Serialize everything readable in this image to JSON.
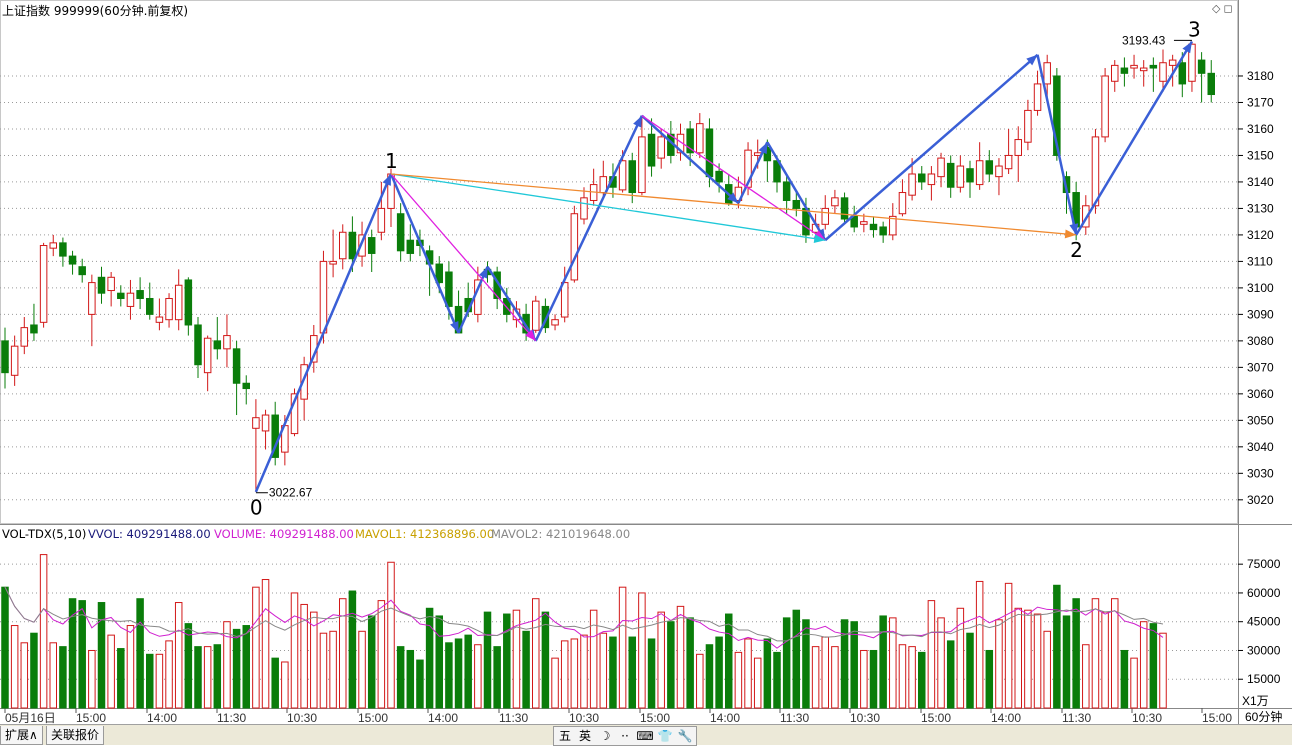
{
  "header": {
    "title": "上证指数 999999(60分钟.前复权)",
    "window_controls": "◇◻"
  },
  "volume_header": {
    "indicator": "VOL-TDX(5,10)",
    "vvol": "VVOL: 409291488.00",
    "volume": "VOLUME: 409291488.00",
    "mavol1": "MAVOL1: 412368896.00",
    "mavol2": "MAVOL2: 421019648.00"
  },
  "annotations": {
    "low_label": "3022.67",
    "high_label": "3193.43",
    "wave_labels": [
      "0",
      "1",
      "2",
      "3"
    ]
  },
  "bottom_bar": {
    "tab_expand": "扩展∧",
    "tab_quote": "关联报价",
    "ime_buttons": [
      "五",
      "英",
      "☽",
      "··",
      "⌨",
      "👕",
      "🔧"
    ]
  },
  "colors": {
    "up": "#d21818",
    "down": "#0a7d0a",
    "grid": "#9a9a9a",
    "wave_blue": "#3a5fd6",
    "wave_magenta": "#e020e0",
    "wave_cyan": "#20c8d8",
    "wave_orange": "#f08a30",
    "vvol_color": "#1a1a7a",
    "volume_color": "#d020d0",
    "mavol1_color": "#c8a000",
    "mavol2_color": "#888888"
  },
  "chart_data": {
    "type": "candlestick",
    "price_axis": {
      "ticks": [
        3020,
        3030,
        3040,
        3050,
        3060,
        3070,
        3080,
        3090,
        3100,
        3110,
        3120,
        3130,
        3140,
        3150,
        3160,
        3170,
        3180
      ],
      "range": [
        3012,
        3200
      ]
    },
    "volume_axis": {
      "ticks": [
        15000,
        30000,
        45000,
        60000,
        75000
      ],
      "unit": "X1万",
      "range": [
        0,
        85000
      ]
    },
    "x_axis": {
      "labels": [
        "05月16日",
        "15:00",
        "14:00",
        "11:30",
        "10:30",
        "15:00",
        "14:00",
        "11:30",
        "10:30",
        "15:00",
        "14:00",
        "11:30",
        "10:30",
        "15:00",
        "14:00",
        "11:30",
        "10:30",
        "15:00"
      ],
      "period_label": "60分钟"
    },
    "candles": [
      [
        3080,
        3068,
        3085,
        3062
      ],
      [
        3067,
        3078,
        3082,
        3063
      ],
      [
        3078,
        3085,
        3089,
        3075
      ],
      [
        3086,
        3083,
        3094,
        3080
      ],
      [
        3087,
        3116,
        3117,
        3085
      ],
      [
        3115,
        3117,
        3120,
        3112
      ],
      [
        3117,
        3112,
        3119,
        3108
      ],
      [
        3112,
        3109,
        3114,
        3105
      ],
      [
        3108,
        3105,
        3111,
        3102
      ],
      [
        3090,
        3102,
        3105,
        3078
      ],
      [
        3104,
        3098,
        3108,
        3094
      ],
      [
        3099,
        3104,
        3106,
        3093
      ],
      [
        3098,
        3096,
        3101,
        3093
      ],
      [
        3093,
        3098,
        3103,
        3088
      ],
      [
        3099,
        3096,
        3104,
        3092
      ],
      [
        3096,
        3090,
        3102,
        3088
      ],
      [
        3087,
        3089,
        3096,
        3084
      ],
      [
        3088,
        3096,
        3098,
        3085
      ],
      [
        3088,
        3101,
        3107,
        3084
      ],
      [
        3103,
        3086,
        3104,
        3082
      ],
      [
        3086,
        3071,
        3089,
        3066
      ],
      [
        3068,
        3081,
        3082,
        3061
      ],
      [
        3080,
        3077,
        3089,
        3073
      ],
      [
        3077,
        3082,
        3090,
        3070
      ],
      [
        3077,
        3064,
        3080,
        3052
      ],
      [
        3064,
        3062,
        3067,
        3056
      ],
      [
        3047,
        3051,
        3058,
        3023
      ],
      [
        3046,
        3052,
        3054,
        3039
      ],
      [
        3052,
        3036,
        3057,
        3033
      ],
      [
        3038,
        3048,
        3052,
        3033
      ],
      [
        3045,
        3060,
        3062,
        3044
      ],
      [
        3058,
        3071,
        3074,
        3050
      ],
      [
        3072,
        3082,
        3086,
        3068
      ],
      [
        3083,
        3110,
        3114,
        3079
      ],
      [
        3109,
        3110,
        3122,
        3104
      ],
      [
        3111,
        3121,
        3124,
        3107
      ],
      [
        3121,
        3111,
        3127,
        3106
      ],
      [
        3112,
        3120,
        3125,
        3108
      ],
      [
        3119,
        3113,
        3122,
        3106
      ],
      [
        3121,
        3130,
        3140,
        3118
      ],
      [
        3130,
        3143,
        3145,
        3123
      ],
      [
        3128,
        3114,
        3132,
        3110
      ],
      [
        3118,
        3113,
        3124,
        3110
      ],
      [
        3118,
        3116,
        3122,
        3112
      ],
      [
        3114,
        3109,
        3116,
        3097
      ],
      [
        3109,
        3102,
        3112,
        3098
      ],
      [
        3106,
        3093,
        3110,
        3088
      ],
      [
        3093,
        3083,
        3099,
        3083
      ],
      [
        3096,
        3091,
        3102,
        3089
      ],
      [
        3090,
        3103,
        3108,
        3087
      ],
      [
        3107,
        3105,
        3110,
        3102
      ],
      [
        3106,
        3096,
        3108,
        3092
      ],
      [
        3096,
        3090,
        3100,
        3087
      ],
      [
        3088,
        3092,
        3095,
        3085
      ],
      [
        3090,
        3083,
        3094,
        3080
      ],
      [
        3084,
        3095,
        3097,
        3083
      ],
      [
        3093,
        3085,
        3096,
        3083
      ],
      [
        3086,
        3088,
        3090,
        3084
      ],
      [
        3089,
        3102,
        3108,
        3087
      ],
      [
        3103,
        3128,
        3131,
        3102
      ],
      [
        3126,
        3134,
        3138,
        3124
      ],
      [
        3133,
        3139,
        3145,
        3131
      ],
      [
        3136,
        3142,
        3148,
        3134
      ],
      [
        3142,
        3138,
        3147,
        3134
      ],
      [
        3137,
        3148,
        3152,
        3136
      ],
      [
        3148,
        3136,
        3151,
        3132
      ],
      [
        3136,
        3157,
        3165,
        3135
      ],
      [
        3158,
        3146,
        3164,
        3142
      ],
      [
        3149,
        3157,
        3160,
        3145
      ],
      [
        3158,
        3150,
        3163,
        3147
      ],
      [
        3151,
        3158,
        3162,
        3148
      ],
      [
        3160,
        3151,
        3163,
        3146
      ],
      [
        3151,
        3162,
        3166,
        3149
      ],
      [
        3160,
        3142,
        3164,
        3138
      ],
      [
        3144,
        3140,
        3147,
        3136
      ],
      [
        3139,
        3132,
        3143,
        3131
      ],
      [
        3133,
        3138,
        3142,
        3130
      ],
      [
        3138,
        3152,
        3155,
        3135
      ],
      [
        3150,
        3151,
        3156,
        3145
      ],
      [
        3153,
        3148,
        3156,
        3140
      ],
      [
        3148,
        3140,
        3150,
        3136
      ],
      [
        3140,
        3133,
        3143,
        3128
      ],
      [
        3133,
        3130,
        3136,
        3127
      ],
      [
        3130,
        3120,
        3134,
        3117
      ],
      [
        3121,
        3124,
        3128,
        3118
      ],
      [
        3124,
        3130,
        3135,
        3122
      ],
      [
        3131,
        3134,
        3137,
        3128
      ],
      [
        3134,
        3126,
        3136,
        3124
      ],
      [
        3127,
        3123,
        3131,
        3121
      ],
      [
        3124,
        3125,
        3128,
        3121
      ],
      [
        3124,
        3122,
        3127,
        3119
      ],
      [
        3123,
        3120,
        3125,
        3117
      ],
      [
        3120,
        3127,
        3132,
        3118
      ],
      [
        3128,
        3136,
        3141,
        3127
      ],
      [
        3135,
        3143,
        3149,
        3133
      ],
      [
        3143,
        3140,
        3146,
        3137
      ],
      [
        3139,
        3143,
        3146,
        3133
      ],
      [
        3142,
        3149,
        3151,
        3138
      ],
      [
        3147,
        3138,
        3150,
        3134
      ],
      [
        3138,
        3146,
        3150,
        3136
      ],
      [
        3145,
        3140,
        3148,
        3134
      ],
      [
        3139,
        3148,
        3155,
        3137
      ],
      [
        3148,
        3143,
        3152,
        3140
      ],
      [
        3142,
        3146,
        3149,
        3135
      ],
      [
        3145,
        3150,
        3160,
        3143
      ],
      [
        3150,
        3156,
        3161,
        3140
      ],
      [
        3155,
        3167,
        3171,
        3152
      ],
      [
        3167,
        3177,
        3182,
        3165
      ],
      [
        3177,
        3185,
        3188,
        3172
      ],
      [
        3180,
        3150,
        3183,
        3148
      ],
      [
        3142,
        3136,
        3144,
        3128
      ],
      [
        3136,
        3123,
        3140,
        3118
      ],
      [
        3123,
        3131,
        3135,
        3120
      ],
      [
        3131,
        3157,
        3160,
        3128
      ],
      [
        3157,
        3180,
        3183,
        3155
      ],
      [
        3178,
        3184,
        3186,
        3174
      ],
      [
        3183,
        3181,
        3187,
        3176
      ],
      [
        3183,
        3184,
        3188,
        3179
      ],
      [
        3182,
        3183,
        3186,
        3176
      ],
      [
        3184,
        3183,
        3187,
        3174
      ],
      [
        3178,
        3185,
        3190,
        3174
      ],
      [
        3184,
        3186,
        3188,
        3176
      ],
      [
        3185,
        3177,
        3189,
        3172
      ],
      [
        3178,
        3192,
        3193,
        3174
      ],
      [
        3186,
        3181,
        3189,
        3170
      ],
      [
        3181,
        3173,
        3186,
        3170
      ]
    ],
    "candle_volumes": [
      63000,
      43000,
      34000,
      39000,
      80000,
      34000,
      32000,
      57000,
      56000,
      30000,
      55000,
      38000,
      31000,
      43000,
      57000,
      28000,
      28000,
      35000,
      55000,
      44000,
      32000,
      32000,
      33000,
      45000,
      41000,
      43000,
      63000,
      67000,
      26000,
      24000,
      60000,
      54000,
      50000,
      39000,
      40000,
      57000,
      61000,
      40000,
      48000,
      56000,
      76000,
      32000,
      30000,
      25000,
      52000,
      48000,
      34000,
      36000,
      38000,
      33000,
      50000,
      32000,
      49000,
      51000,
      40000,
      57000,
      50000,
      26000,
      35000,
      36000,
      38000,
      51000,
      39000,
      37000,
      63000,
      37000,
      60000,
      36000,
      50000,
      45000,
      53000,
      47000,
      28000,
      33000,
      37000,
      49000,
      29000,
      36000,
      26000,
      36000,
      29000,
      47000,
      51000,
      46000,
      32000,
      37000,
      32000,
      46000,
      45000,
      30000,
      30000,
      48000,
      47000,
      33000,
      32000,
      29000,
      56000,
      47000,
      35000,
      52000,
      39000,
      66000,
      30000,
      46000,
      65000,
      52000,
      51000,
      49000,
      40000,
      64000,
      48000,
      57000,
      33000,
      57000,
      50000,
      57000,
      30000,
      26000,
      45000,
      44000,
      39000
    ],
    "volume_mas": {
      "mavol1": "5-period average of candle_volumes",
      "mavol2": "10-period average of candle_volumes"
    },
    "wave_points": [
      {
        "label": "0",
        "index": 26,
        "price": 3022.67
      },
      {
        "label": "1",
        "index": 40,
        "price": 3143
      },
      {
        "label": "2",
        "index": 111,
        "price": 3120
      },
      {
        "label": "3",
        "index": 123,
        "price": 3193.43
      }
    ],
    "wave_segments": [
      {
        "color": "wave_blue",
        "from": [
          26,
          3023
        ],
        "to": [
          40,
          3143
        ]
      },
      {
        "color": "wave_blue",
        "from": [
          40,
          3143
        ],
        "to": [
          47,
          3083
        ]
      },
      {
        "color": "wave_blue",
        "from": [
          47,
          3083
        ],
        "to": [
          50,
          3108
        ]
      },
      {
        "color": "wave_blue",
        "from": [
          50,
          3108
        ],
        "to": [
          55,
          3080
        ]
      },
      {
        "color": "wave_blue",
        "from": [
          55,
          3080
        ],
        "to": [
          66,
          3165
        ]
      },
      {
        "color": "wave_blue",
        "from": [
          66,
          3165
        ],
        "to": [
          76,
          3132
        ]
      },
      {
        "color": "wave_blue",
        "from": [
          76,
          3132
        ],
        "to": [
          79,
          3155
        ]
      },
      {
        "color": "wave_blue",
        "from": [
          79,
          3155
        ],
        "to": [
          85,
          3118
        ]
      },
      {
        "color": "wave_blue",
        "from": [
          85,
          3118
        ],
        "to": [
          107,
          3188
        ]
      },
      {
        "color": "wave_blue",
        "from": [
          107,
          3188
        ],
        "to": [
          111,
          3120
        ]
      },
      {
        "color": "wave_blue",
        "from": [
          111,
          3120
        ],
        "to": [
          123,
          3193
        ]
      },
      {
        "color": "wave_magenta",
        "from": [
          40,
          3143
        ],
        "to": [
          55,
          3080
        ]
      },
      {
        "color": "wave_magenta",
        "from": [
          66,
          3165
        ],
        "to": [
          85,
          3118
        ]
      },
      {
        "color": "wave_cyan",
        "from": [
          40,
          3143
        ],
        "to": [
          85,
          3118
        ]
      },
      {
        "color": "wave_orange",
        "from": [
          40,
          3143
        ],
        "to": [
          111,
          3120
        ]
      }
    ]
  }
}
